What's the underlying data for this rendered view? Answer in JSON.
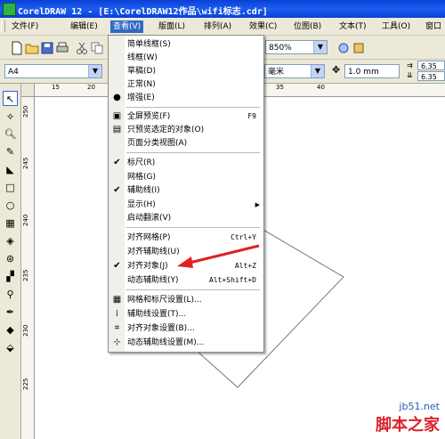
{
  "window": {
    "title": "CorelDRAW 12 - [E:\\CorelDRAW12作品\\wifi标志.cdr]"
  },
  "menubar": {
    "items": [
      "文件(F)",
      "编辑(E)",
      "查看(V)",
      "版面(L)",
      "排列(A)",
      "效果(C)",
      "位图(B)",
      "文本(T)",
      "工具(O)",
      "窗口"
    ]
  },
  "toolbar": {
    "zoom": "850%",
    "page_size": "A4",
    "units": "毫米",
    "nudge": "1.0 mm",
    "dup_x": "6.35 m",
    "dup_y": "6.35 m"
  },
  "ruler": {
    "h_labels": [
      "15",
      "20",
      "35",
      "40"
    ],
    "v_labels": [
      "250",
      "245",
      "240",
      "235",
      "230",
      "225"
    ]
  },
  "view_menu": {
    "items": [
      {
        "label": "简单线框(S)",
        "shortcut": "",
        "icon": "none"
      },
      {
        "label": "线框(W)",
        "shortcut": "",
        "icon": "none"
      },
      {
        "label": "草稿(D)",
        "shortcut": "",
        "icon": "none"
      },
      {
        "label": "正常(N)",
        "shortcut": "",
        "icon": "none"
      },
      {
        "label": "增强(E)",
        "shortcut": "",
        "icon": "radio-dot-icon"
      },
      {
        "label": "全屏预览(F)",
        "shortcut": "F9",
        "icon": "fullscreen-preview-icon"
      },
      {
        "label": "只预览选定的对象(O)",
        "shortcut": "",
        "icon": "preview-selected-icon"
      },
      {
        "label": "页面分类视图(A)",
        "shortcut": "",
        "icon": "none"
      },
      {
        "label": "标尺(R)",
        "shortcut": "",
        "icon": "checkmark-icon"
      },
      {
        "label": "网格(G)",
        "shortcut": "",
        "icon": "none"
      },
      {
        "label": "辅助线(I)",
        "shortcut": "",
        "icon": "checkmark-icon"
      },
      {
        "label": "显示(H)",
        "shortcut": "",
        "icon": "none"
      },
      {
        "label": "启动翻滚(V)",
        "shortcut": "",
        "icon": "none"
      },
      {
        "label": "对齐网格(P)",
        "shortcut": "Ctrl+Y",
        "icon": "none"
      },
      {
        "label": "对齐辅助线(U)",
        "shortcut": "",
        "icon": "none"
      },
      {
        "label": "对齐对象(J)",
        "shortcut": "Alt+Z",
        "icon": "checkmark-icon"
      },
      {
        "label": "动态辅助线(Y)",
        "shortcut": "Alt+Shift+D",
        "icon": "none"
      },
      {
        "label": "网格和标尺设置(L)...",
        "shortcut": "",
        "icon": "grid-settings-icon"
      },
      {
        "label": "辅助线设置(T)...",
        "shortcut": "",
        "icon": "guideline-settings-icon"
      },
      {
        "label": "对齐对象设置(B)...",
        "shortcut": "",
        "icon": "snap-settings-icon"
      },
      {
        "label": "动态辅助线设置(M)...",
        "shortcut": "",
        "icon": "dynamic-guides-icon"
      }
    ]
  },
  "watermark": {
    "line1": "jb51.net",
    "line2": "脚本之家"
  },
  "colors": {
    "titlebar": "#0a3fd6",
    "menu_highlight": "#316ac5",
    "arrow": "#e02020"
  }
}
